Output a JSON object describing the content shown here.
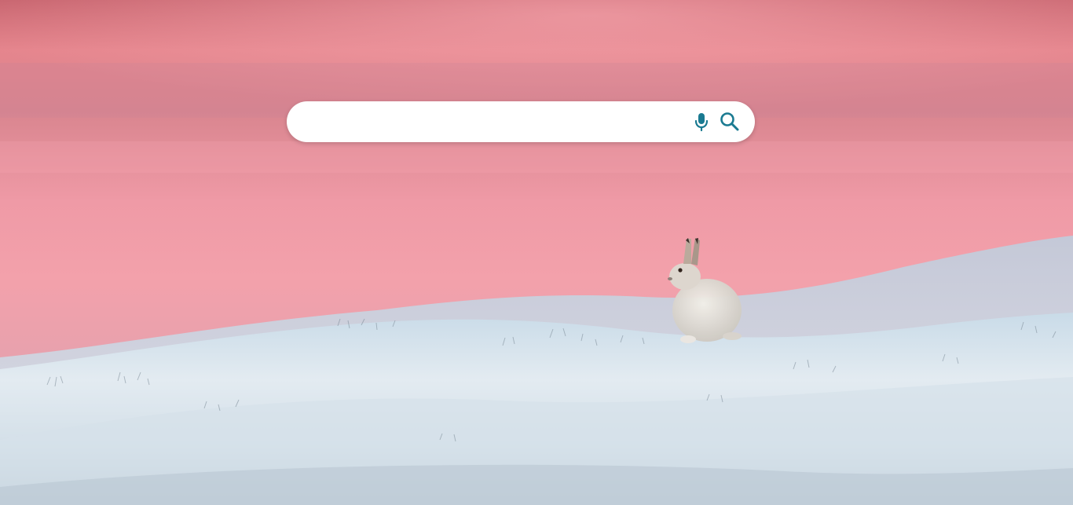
{
  "search": {
    "value": "",
    "placeholder": ""
  },
  "icons": {
    "microphone": "microphone-icon",
    "search": "search-icon"
  },
  "colors": {
    "accent": "#1a7a91",
    "search_box_background": "#ffffff",
    "sky_top": "#d77a80",
    "sky_bottom": "#f3a3ad",
    "snow": "#dce6ee"
  },
  "background": {
    "subject": "hare"
  }
}
